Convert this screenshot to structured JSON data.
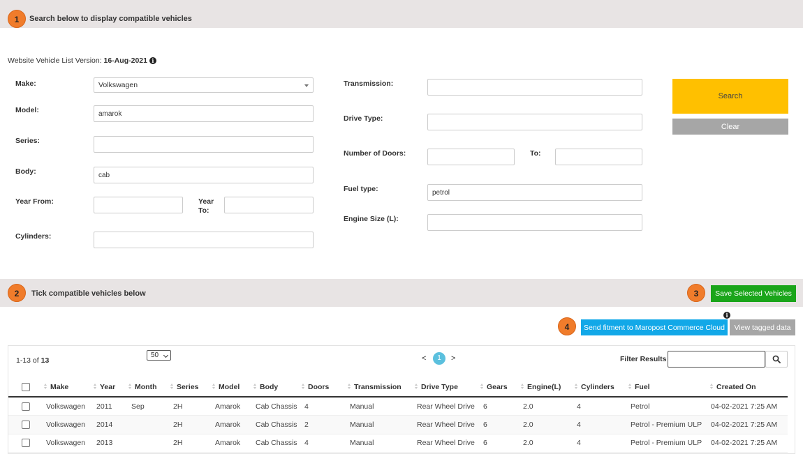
{
  "section1": {
    "step": "1",
    "title": "Search below to display compatible vehicles"
  },
  "version": {
    "label": "Website Vehicle List Version: ",
    "value": "16-Aug-2021",
    "info_icon": "info-icon"
  },
  "form": {
    "make": {
      "label": "Make:",
      "value": "Volkswagen"
    },
    "model": {
      "label": "Model:",
      "value": "amarok"
    },
    "series": {
      "label": "Series:",
      "value": ""
    },
    "body": {
      "label": "Body:",
      "value": "cab"
    },
    "year_from": {
      "label": "Year From:",
      "value": ""
    },
    "year_to": {
      "label_line1": "Year",
      "label_line2": "To:",
      "value": ""
    },
    "cylinders": {
      "label": "Cylinders:",
      "value": ""
    },
    "transmission": {
      "label": "Transmission:",
      "value": ""
    },
    "drive_type": {
      "label": "Drive Type:",
      "value": ""
    },
    "doors": {
      "label": "Number of Doors:",
      "value": ""
    },
    "doors_to": {
      "label": "To:",
      "value": ""
    },
    "fuel_type": {
      "label": "Fuel type:",
      "value": "petrol"
    },
    "engine_size": {
      "label": "Engine Size (L):",
      "value": ""
    }
  },
  "buttons": {
    "search": "Search",
    "clear": "Clear",
    "save": "Save Selected Vehicles",
    "send": "Send fitment to Maropost Commerce Cloud",
    "view": "View tagged data"
  },
  "section2": {
    "step": "2",
    "title": "Tick compatible vehicles below",
    "step3": "3",
    "step4": "4"
  },
  "results": {
    "range": "1-13",
    "of_label": " of ",
    "total": "13",
    "page_size": "50",
    "pager": {
      "prev": "<",
      "current": "1",
      "next": ">"
    },
    "filter_label": "Filter Results",
    "filter_value": "",
    "search_icon": "search-icon"
  },
  "colors": {
    "search": "#ffc000",
    "clear": "#a6a6a6",
    "save": "#1aa51a",
    "send": "#12a8e8",
    "view": "#a6a6a6",
    "step": "#f07c2b",
    "pager": "#5bc0de"
  },
  "table": {
    "headers": [
      "Make",
      "Year",
      "Month",
      "Series",
      "Model",
      "Body",
      "Doors",
      "Transmission",
      "Drive Type",
      "Gears",
      "Engine(L)",
      "Cylinders",
      "Fuel",
      "Created On"
    ],
    "rows": [
      [
        "Volkswagen",
        "2011",
        "Sep",
        "2H",
        "Amarok",
        "Cab Chassis",
        "4",
        "Manual",
        "Rear Wheel Drive",
        "6",
        "2.0",
        "4",
        "Petrol",
        "04-02-2021 7:25 AM"
      ],
      [
        "Volkswagen",
        "2014",
        "",
        "2H",
        "Amarok",
        "Cab Chassis",
        "2",
        "Manual",
        "Rear Wheel Drive",
        "6",
        "2.0",
        "4",
        "Petrol - Premium ULP",
        "04-02-2021 7:25 AM"
      ],
      [
        "Volkswagen",
        "2013",
        "",
        "2H",
        "Amarok",
        "Cab Chassis",
        "4",
        "Manual",
        "Rear Wheel Drive",
        "6",
        "2.0",
        "4",
        "Petrol - Premium ULP",
        "04-02-2021 7:25 AM"
      ]
    ]
  }
}
